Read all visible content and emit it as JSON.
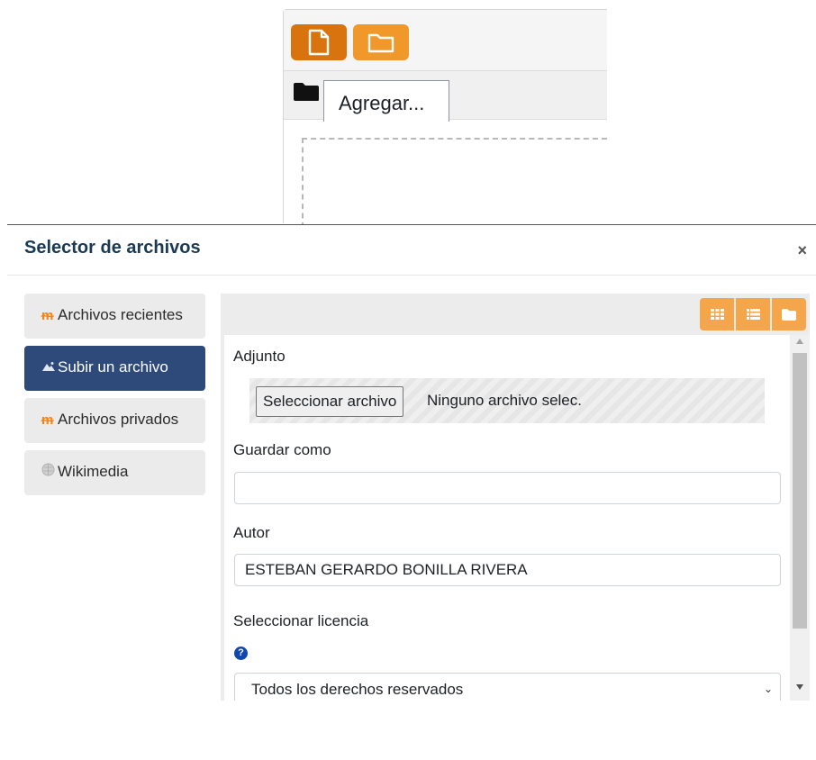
{
  "background": {
    "file_button_icon": "file-icon",
    "folder_button_icon": "folder-icon",
    "path_folder_icon": "folder-icon",
    "add_button_label": "Agregar..."
  },
  "modal": {
    "title": "Selector de archivos",
    "close_label": "×"
  },
  "repositories": [
    {
      "label": "Archivos recientes",
      "icon": "moodle-icon"
    },
    {
      "label": "Subir un archivo",
      "icon": "upload-icon",
      "active": true
    },
    {
      "label": "Archivos privados",
      "icon": "moodle-icon"
    },
    {
      "label": "Wikimedia",
      "icon": "wikimedia-icon"
    }
  ],
  "view_buttons": [
    "grid-view-icon",
    "list-view-icon",
    "folder-view-icon"
  ],
  "form": {
    "attachment_label": "Adjunto",
    "choose_file_button": "Seleccionar archivo",
    "file_status": "Ninguno archivo selec.",
    "save_as_label": "Guardar como",
    "save_as_value": "",
    "author_label": "Autor",
    "author_value": "ESTEBAN GERARDO BONILLA RIVERA",
    "license_label": "Seleccionar licencia",
    "license_help_icon": "question-icon",
    "license_selected": "Todos los derechos reservados"
  },
  "colors": {
    "accent_orange": "#f5a54a",
    "file_button": "#d9730d",
    "active_repo": "#2d4a7a",
    "title": "#1a3a52"
  }
}
